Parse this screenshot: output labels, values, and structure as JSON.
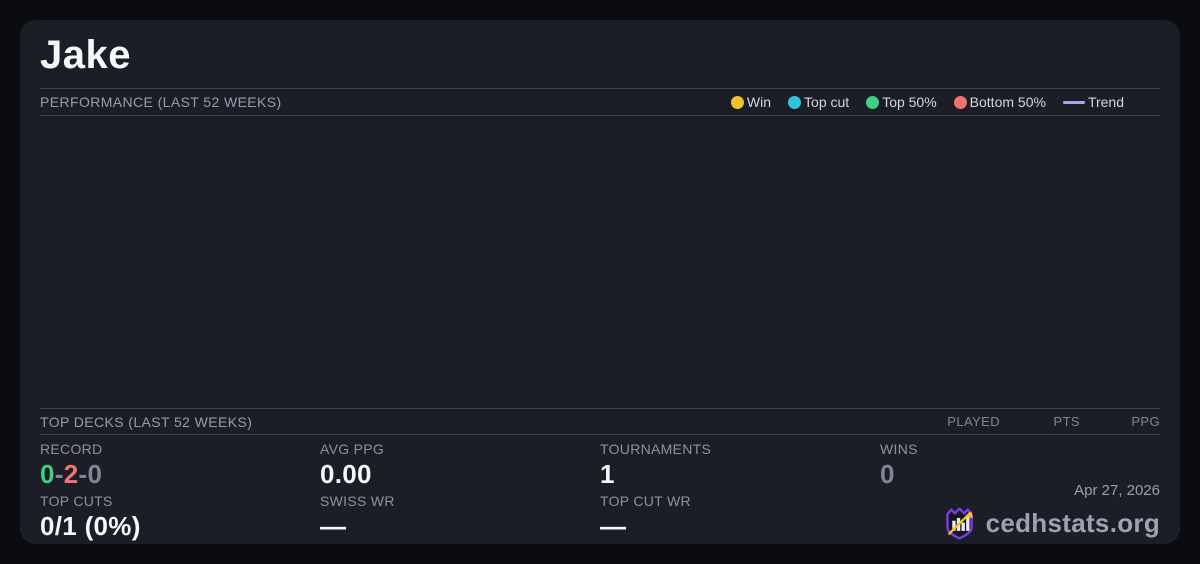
{
  "player": {
    "name": "Jake"
  },
  "performance": {
    "title": "PERFORMANCE (LAST 52 WEEKS)",
    "legend": [
      {
        "label": "Win",
        "color": "#f1c130",
        "type": "dot"
      },
      {
        "label": "Top cut",
        "color": "#31c5dd",
        "type": "dot"
      },
      {
        "label": "Top 50%",
        "color": "#3fcf81",
        "type": "dot"
      },
      {
        "label": "Bottom 50%",
        "color": "#f17070",
        "type": "dot"
      },
      {
        "label": "Trend",
        "color": "#b2a1e9",
        "type": "line"
      }
    ]
  },
  "chart_data": {
    "type": "scatter",
    "title": "PERFORMANCE (LAST 52 WEEKS)",
    "series": [],
    "note": "chart plot area is empty in screenshot"
  },
  "top_decks": {
    "title": "TOP DECKS (LAST 52 WEEKS)",
    "columns": [
      "PLAYED",
      "PTS",
      "PPG"
    ],
    "rows": []
  },
  "stats": {
    "record": {
      "label": "RECORD",
      "wins": "0",
      "losses": "2",
      "draws": "0",
      "separator": "-"
    },
    "avg_ppg": {
      "label": "AVG PPG",
      "value": "0.00"
    },
    "tournaments": {
      "label": "TOURNAMENTS",
      "value": "1"
    },
    "wins": {
      "label": "WINS",
      "value": "0"
    },
    "top_cuts": {
      "label": "TOP CUTS",
      "value": "0/1 (0%)"
    },
    "swiss_wr": {
      "label": "SWISS WR",
      "value": "—"
    },
    "top_cut_wr": {
      "label": "TOP CUT WR",
      "value": "—"
    }
  },
  "footer": {
    "date": "Apr 27, 2026",
    "brand": "cedhstats.org"
  },
  "colors": {
    "card_bg": "#1b1e27",
    "page_bg": "#0b0c10",
    "divider": "#3b4150",
    "logo_purple": "#7c3aed",
    "logo_arrow": "#f1c130"
  }
}
